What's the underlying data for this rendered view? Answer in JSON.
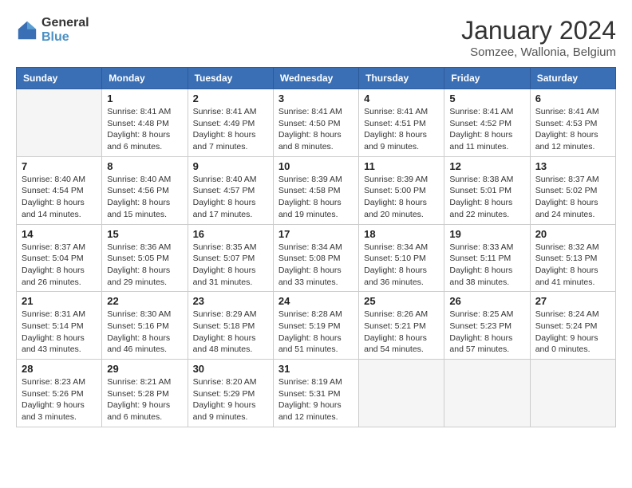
{
  "logo": {
    "line1": "General",
    "line2": "Blue"
  },
  "title": "January 2024",
  "subtitle": "Somzee, Wallonia, Belgium",
  "days_of_week": [
    "Sunday",
    "Monday",
    "Tuesday",
    "Wednesday",
    "Thursday",
    "Friday",
    "Saturday"
  ],
  "weeks": [
    [
      {
        "day": "",
        "info": ""
      },
      {
        "day": "1",
        "info": "Sunrise: 8:41 AM\nSunset: 4:48 PM\nDaylight: 8 hours\nand 6 minutes."
      },
      {
        "day": "2",
        "info": "Sunrise: 8:41 AM\nSunset: 4:49 PM\nDaylight: 8 hours\nand 7 minutes."
      },
      {
        "day": "3",
        "info": "Sunrise: 8:41 AM\nSunset: 4:50 PM\nDaylight: 8 hours\nand 8 minutes."
      },
      {
        "day": "4",
        "info": "Sunrise: 8:41 AM\nSunset: 4:51 PM\nDaylight: 8 hours\nand 9 minutes."
      },
      {
        "day": "5",
        "info": "Sunrise: 8:41 AM\nSunset: 4:52 PM\nDaylight: 8 hours\nand 11 minutes."
      },
      {
        "day": "6",
        "info": "Sunrise: 8:41 AM\nSunset: 4:53 PM\nDaylight: 8 hours\nand 12 minutes."
      }
    ],
    [
      {
        "day": "7",
        "info": "Sunrise: 8:40 AM\nSunset: 4:54 PM\nDaylight: 8 hours\nand 14 minutes."
      },
      {
        "day": "8",
        "info": "Sunrise: 8:40 AM\nSunset: 4:56 PM\nDaylight: 8 hours\nand 15 minutes."
      },
      {
        "day": "9",
        "info": "Sunrise: 8:40 AM\nSunset: 4:57 PM\nDaylight: 8 hours\nand 17 minutes."
      },
      {
        "day": "10",
        "info": "Sunrise: 8:39 AM\nSunset: 4:58 PM\nDaylight: 8 hours\nand 19 minutes."
      },
      {
        "day": "11",
        "info": "Sunrise: 8:39 AM\nSunset: 5:00 PM\nDaylight: 8 hours\nand 20 minutes."
      },
      {
        "day": "12",
        "info": "Sunrise: 8:38 AM\nSunset: 5:01 PM\nDaylight: 8 hours\nand 22 minutes."
      },
      {
        "day": "13",
        "info": "Sunrise: 8:37 AM\nSunset: 5:02 PM\nDaylight: 8 hours\nand 24 minutes."
      }
    ],
    [
      {
        "day": "14",
        "info": "Sunrise: 8:37 AM\nSunset: 5:04 PM\nDaylight: 8 hours\nand 26 minutes."
      },
      {
        "day": "15",
        "info": "Sunrise: 8:36 AM\nSunset: 5:05 PM\nDaylight: 8 hours\nand 29 minutes."
      },
      {
        "day": "16",
        "info": "Sunrise: 8:35 AM\nSunset: 5:07 PM\nDaylight: 8 hours\nand 31 minutes."
      },
      {
        "day": "17",
        "info": "Sunrise: 8:34 AM\nSunset: 5:08 PM\nDaylight: 8 hours\nand 33 minutes."
      },
      {
        "day": "18",
        "info": "Sunrise: 8:34 AM\nSunset: 5:10 PM\nDaylight: 8 hours\nand 36 minutes."
      },
      {
        "day": "19",
        "info": "Sunrise: 8:33 AM\nSunset: 5:11 PM\nDaylight: 8 hours\nand 38 minutes."
      },
      {
        "day": "20",
        "info": "Sunrise: 8:32 AM\nSunset: 5:13 PM\nDaylight: 8 hours\nand 41 minutes."
      }
    ],
    [
      {
        "day": "21",
        "info": "Sunrise: 8:31 AM\nSunset: 5:14 PM\nDaylight: 8 hours\nand 43 minutes."
      },
      {
        "day": "22",
        "info": "Sunrise: 8:30 AM\nSunset: 5:16 PM\nDaylight: 8 hours\nand 46 minutes."
      },
      {
        "day": "23",
        "info": "Sunrise: 8:29 AM\nSunset: 5:18 PM\nDaylight: 8 hours\nand 48 minutes."
      },
      {
        "day": "24",
        "info": "Sunrise: 8:28 AM\nSunset: 5:19 PM\nDaylight: 8 hours\nand 51 minutes."
      },
      {
        "day": "25",
        "info": "Sunrise: 8:26 AM\nSunset: 5:21 PM\nDaylight: 8 hours\nand 54 minutes."
      },
      {
        "day": "26",
        "info": "Sunrise: 8:25 AM\nSunset: 5:23 PM\nDaylight: 8 hours\nand 57 minutes."
      },
      {
        "day": "27",
        "info": "Sunrise: 8:24 AM\nSunset: 5:24 PM\nDaylight: 9 hours\nand 0 minutes."
      }
    ],
    [
      {
        "day": "28",
        "info": "Sunrise: 8:23 AM\nSunset: 5:26 PM\nDaylight: 9 hours\nand 3 minutes."
      },
      {
        "day": "29",
        "info": "Sunrise: 8:21 AM\nSunset: 5:28 PM\nDaylight: 9 hours\nand 6 minutes."
      },
      {
        "day": "30",
        "info": "Sunrise: 8:20 AM\nSunset: 5:29 PM\nDaylight: 9 hours\nand 9 minutes."
      },
      {
        "day": "31",
        "info": "Sunrise: 8:19 AM\nSunset: 5:31 PM\nDaylight: 9 hours\nand 12 minutes."
      },
      {
        "day": "",
        "info": ""
      },
      {
        "day": "",
        "info": ""
      },
      {
        "day": "",
        "info": ""
      }
    ]
  ]
}
